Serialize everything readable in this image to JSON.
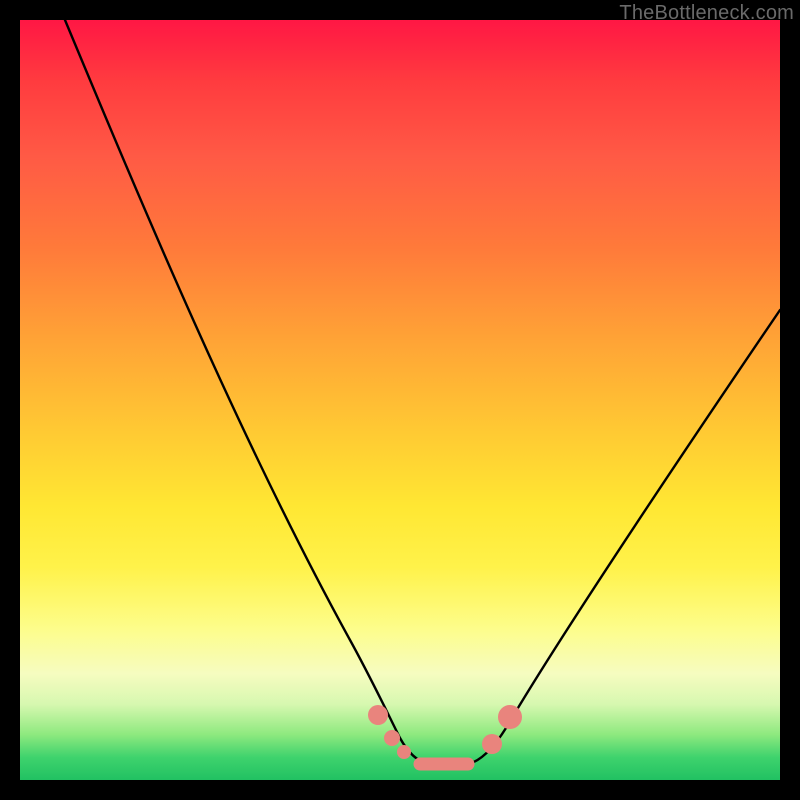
{
  "watermark": {
    "text": "TheBottleneck.com"
  },
  "colors": {
    "curve_stroke": "#000000",
    "marker_fill": "#e9847d",
    "marker_stroke": "#e9847d",
    "background": "#000000"
  },
  "chart_data": {
    "type": "line",
    "title": "",
    "xlabel": "",
    "ylabel": "",
    "xlim": [
      0,
      100
    ],
    "ylim": [
      0,
      100
    ],
    "grid": false,
    "legend": false,
    "notes": "V-shaped bottleneck curve on red→green vertical gradient. Y decreases downward visually (lower = better / green). Values estimated from pixel positions; no axis ticks are shown in the source image.",
    "series": [
      {
        "name": "bottleneck-curve",
        "x": [
          6,
          10,
          15,
          20,
          25,
          30,
          35,
          40,
          44,
          47,
          49,
          51,
          53,
          55,
          57,
          60,
          62,
          65,
          68,
          72,
          78,
          85,
          92,
          100
        ],
        "y": [
          100,
          92,
          83,
          74,
          65,
          56,
          47,
          38,
          28,
          19,
          11,
          6,
          3,
          2,
          2,
          3,
          5,
          9,
          14,
          20,
          29,
          39,
          50,
          62
        ]
      }
    ],
    "markers": [
      {
        "name": "left-knee-upper",
        "x": 47.2,
        "y": 8.2,
        "r": 1.3
      },
      {
        "name": "left-knee-mid",
        "x": 49.0,
        "y": 5.2,
        "r": 1.1
      },
      {
        "name": "left-knee-lower",
        "x": 50.5,
        "y": 3.4,
        "r": 1.0
      },
      {
        "name": "flat-seg-start",
        "x": 52.8,
        "y": 2.1,
        "r": 1.0
      },
      {
        "name": "flat-seg-end",
        "x": 58.5,
        "y": 2.1,
        "r": 1.0
      },
      {
        "name": "right-knee-lower",
        "x": 62.3,
        "y": 4.8,
        "r": 1.3
      },
      {
        "name": "right-knee-upper",
        "x": 64.5,
        "y": 8.3,
        "r": 1.5
      }
    ],
    "flat_segment": {
      "x0": 52.8,
      "x1": 58.5,
      "y": 2.1
    }
  }
}
